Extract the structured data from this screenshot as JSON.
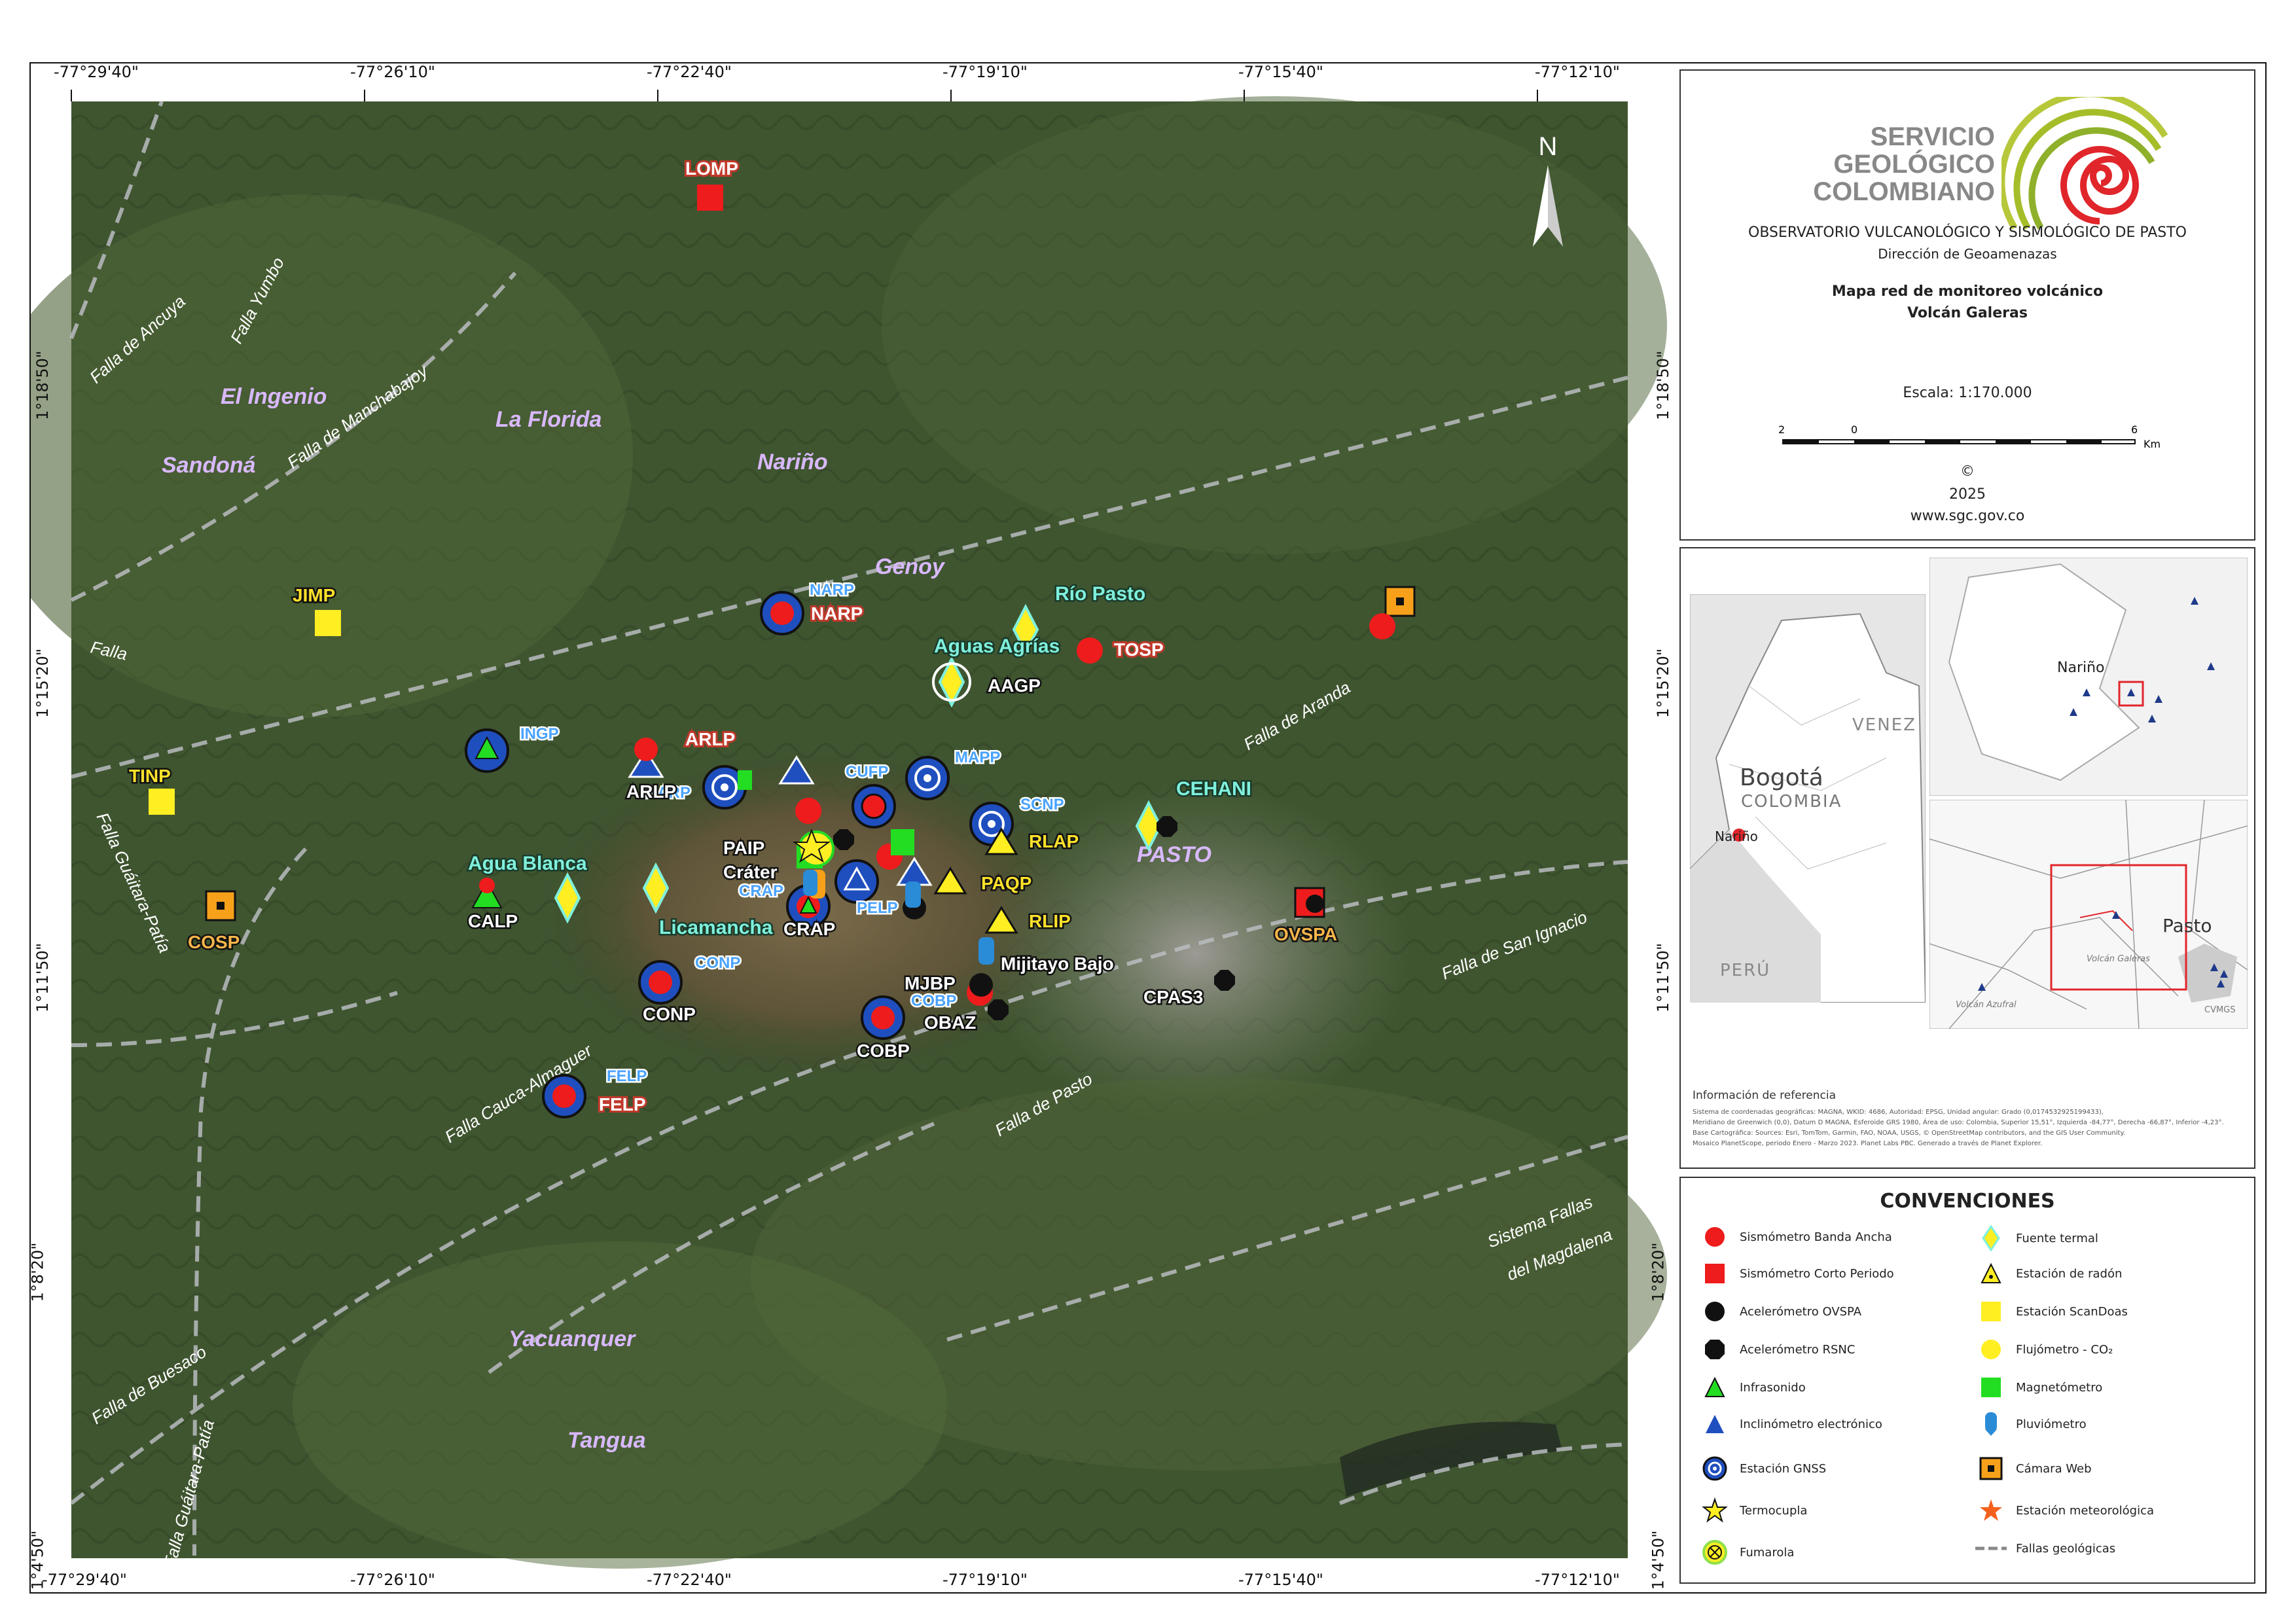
{
  "coords": {
    "lon": [
      "-77°29'40\"",
      "-77°26'10\"",
      "-77°22'40\"",
      "-77°19'10\"",
      "-77°15'40\"",
      "-77°12'10\""
    ],
    "lat": [
      "1°18'50\"",
      "1°15'20\"",
      "1°11'50\"",
      "1°8'20\"",
      "1°4'50\""
    ]
  },
  "header": {
    "logo_line1": "SERVICIO",
    "logo_line2": "GEOLÓGICO",
    "logo_line3": "COLOMBIANO",
    "observatory": "OBSERVATORIO VULCANOLÓGICO Y SISMOLÓGICO DE PASTO",
    "direction": "Dirección de Geoamenazas",
    "map_title1": "Mapa red de monitoreo volcánico",
    "map_title2": "Volcán Galeras",
    "scale_label": "Escala: 1:170.000",
    "scale_ticks": [
      "2",
      "0",
      "6"
    ],
    "scale_unit": "Km",
    "copyright": "©",
    "year": "2025",
    "website": "www.sgc.gov.co"
  },
  "inset": {
    "bogota": "Bogotá",
    "colombia": "COLOMBIA",
    "venez": "VENEZ",
    "peru": "PERÚ",
    "narino_small": "Nariño",
    "narino_mid": "Nariño",
    "pasto": "Pasto",
    "volcan_galeras": "Volcán Galeras",
    "volcan_azufral": "Volcán Azufral",
    "cvmgs": "CVMGS"
  },
  "reference": {
    "title": "Información de referencia",
    "text1": "Sistema de coordenadas geográficas: MAGNA, WKID: 4686, Autoridad: EPSG, Unidad angular: Grado (0,0174532925199433),",
    "text2": "Meridiano de Greenwich (0,0), Datum D MAGNA, Esferoide GRS 1980, Área de uso: Colombia, Superior 15,51°, Izquierda -84,77°, Derecha -66,87°, Inferior -4,23°.",
    "text3": "Base Cartográfica: Sources: Esri, TomTom, Garmin, FAO, NOAA, USGS, © OpenStreetMap contributors, and the GIS User Community.",
    "text4": "Mosaico PlanetScope, periodo Enero - Marzo 2023. Planet Labs PBC. Generado a través de Planet Explorer."
  },
  "legend": {
    "title": "CONVENCIONES",
    "left": [
      "Sismómetro Banda Ancha",
      "Sismómetro Corto Periodo",
      "Acelerómetro OVSPA",
      "Acelerómetro RSNC",
      "Infrasonido",
      "Inclinómetro electrónico",
      "Estación GNSS",
      "Termocupla",
      "Fumarola"
    ],
    "right": [
      "Fuente termal",
      "Estación de radón",
      "Estación ScanDoas",
      "Flujómetro - CO₂",
      "Magnetómetro",
      "Pluviómetro",
      "Cámara Web",
      "Estación meteorológica",
      "Fallas geológicas"
    ]
  },
  "map": {
    "north": "N",
    "towns": [
      "El Ingenio",
      "La Florida",
      "Sandoná",
      "Nariño",
      "Genoy",
      "PASTO",
      "Yacuanquer",
      "Tangua"
    ],
    "faults": [
      "Falla de Ancuya",
      "Falla Yumbo",
      "Falla de Manchabajoy",
      "Falla",
      "Falla Guáitara-Patía",
      "Falla Cauca-Almaguer",
      "Falla de Buesaco",
      "Falla Guáitara-Patía",
      "Falla de Aranda",
      "Falla de San Ignacio",
      "Falla de Pasto",
      "Sistema Fallas",
      "del Magdalena"
    ],
    "stations": {
      "lomp": "LOMP",
      "jimp": "JIMP",
      "tinp": "TINP",
      "cosp": "COSP",
      "narp_gnss": "NARP",
      "narp": "NARP",
      "rio_pasto": "Río Pasto",
      "tosp": "TOSP",
      "aguas_agrias": "Aguas Agrías",
      "aagp": "AAGP",
      "ingp": "INGP",
      "arlp_a": "ARLP",
      "arlp_b": "ARLP",
      "barp": "BARP",
      "cufp": "CUFP",
      "mapp": "MAPP",
      "scnp": "SCNP",
      "cehani": "CEHANI",
      "paip": "PAIP",
      "crater": "Cráter",
      "crap_gnss": "CRAP",
      "crap": "CRAP",
      "agua_blanca": "Agua Blanca",
      "calp": "CALP",
      "licamancha": "Licamancha",
      "pelp": "PELP",
      "paqp": "PAQP",
      "rlap": "RLAP",
      "rlip": "RLIP",
      "mijitayo": "Mijitayo Bajo",
      "mjbp": "MJBP",
      "obaz": "OBAZ",
      "conp_gnss": "CONP",
      "conp": "CONP",
      "cobp_gnss": "COBP",
      "cobp": "COBP",
      "felp_gnss": "FELP",
      "felp": "FELP",
      "cpas3": "CPAS3",
      "ovspa": "OVSPA"
    }
  },
  "colors": {
    "red": "#ee1c1c",
    "blue": "#1f4fbf",
    "green": "#22dd22",
    "yellow": "#ffee22",
    "orange": "#f7a11a",
    "cyan": "#7ff0dc",
    "label_red": "#c0392b",
    "label_blue": "#4aa3ff",
    "label_green": "#7ff0dc",
    "label_yellow": "#ffe12b",
    "town": "#d8b8ff"
  }
}
